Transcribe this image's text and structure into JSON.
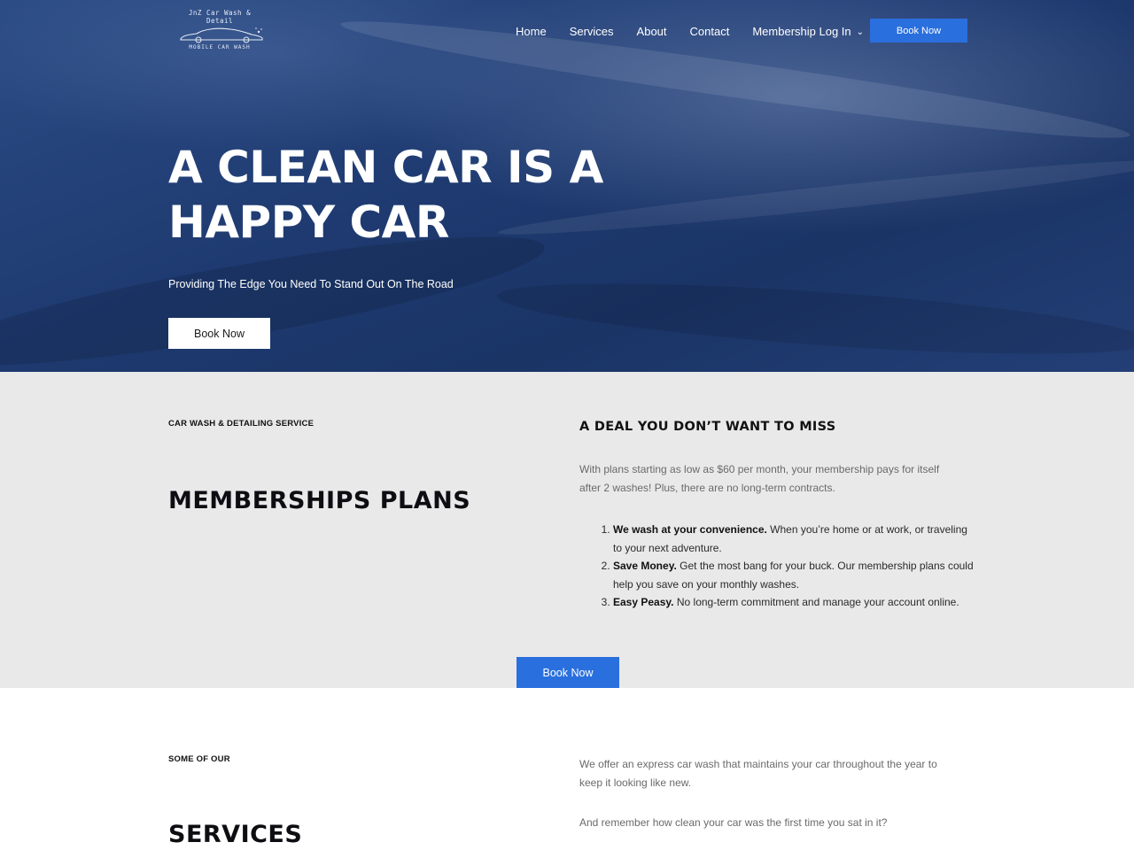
{
  "logo": {
    "line1": "JnZ Car Wash &",
    "line2": "Detail",
    "line3": "MOBILE CAR WASH"
  },
  "nav": {
    "items": [
      "Home",
      "Services",
      "About",
      "Contact",
      "Membership Log In"
    ],
    "book_label": "Book Now"
  },
  "hero": {
    "title_line1": "A CLEAN CAR IS A",
    "title_line2": "HAPPY CAR",
    "subtitle": "Providing The Edge You Need To Stand Out On The Road",
    "button_label": "Book Now"
  },
  "membership": {
    "eyebrow": "CAR WASH & DETAILING SERVICE",
    "title": "MEMBERSHIPS PLANS",
    "deal_title": "A DEAL YOU DON’T WANT TO MISS",
    "intro_line1": "With plans starting as low as $60 per month, your membership pays for itself",
    "intro_line2": "after 2 washes! Plus, there are no long-term contracts.",
    "benefits": [
      {
        "bold": "We wash at your convenience.",
        "text": " When you’re home or at work, or traveling to your next adventure."
      },
      {
        "bold": "Save Money.",
        "text": " Get the most bang for your buck. Our membership plans could help you save on your monthly washes."
      },
      {
        "bold": "Easy Peasy.",
        "text": " No long-term commitment and manage your account online."
      }
    ],
    "button_label": "Book Now"
  },
  "services": {
    "eyebrow": "SOME OF OUR",
    "title": "SERVICES",
    "para1_line1": "We offer an express car wash that maintains your car throughout the year to",
    "para1_line2": "keep it looking like new.",
    "para2": "And remember how clean your car was the first time you sat in it?"
  },
  "colors": {
    "accent": "#2a6fde",
    "hero_bg": "#1e3a70",
    "section_bg": "#e9e9ea"
  }
}
